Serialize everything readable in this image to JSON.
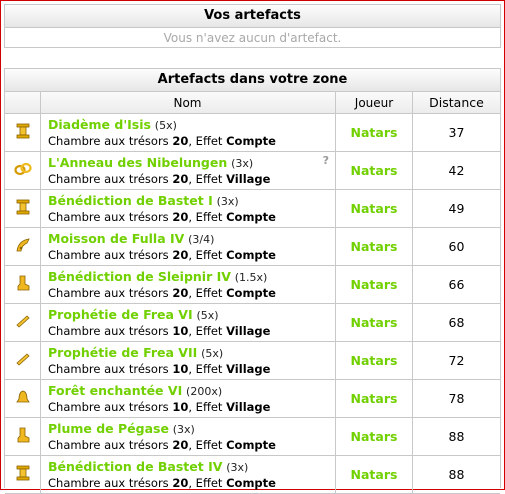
{
  "own_section": {
    "title": "Vos artefacts",
    "empty_text": "Vous n'avez aucun d'artefact."
  },
  "zone_section": {
    "title": "Artefacts dans votre zone",
    "columns": {
      "name": "Nom",
      "player": "Joueur",
      "distance": "Distance"
    },
    "desc_prefix": "Chambre aux trésors",
    "desc_effect": "Effet",
    "help_mark": "?",
    "rows": [
      {
        "icon": "pillar-icon",
        "name": "Diadème d'Isis",
        "bonus": "(5x)",
        "level": "20",
        "effect": "Compte",
        "player": "Natars",
        "distance": "37"
      },
      {
        "icon": "ring-icon",
        "name": "L'Anneau des Nibelungen",
        "bonus": "(3x)",
        "level": "20",
        "effect": "Village",
        "player": "Natars",
        "distance": "42"
      },
      {
        "icon": "pillar-icon",
        "name": "Bénédiction de Bastet I",
        "bonus": "(3x)",
        "level": "20",
        "effect": "Compte",
        "player": "Natars",
        "distance": "49"
      },
      {
        "icon": "horn-icon",
        "name": "Moisson de Fulla IV",
        "bonus": "(3/4)",
        "level": "20",
        "effect": "Compte",
        "player": "Natars",
        "distance": "60"
      },
      {
        "icon": "boot-icon",
        "name": "Bénédiction de Sleipnir IV",
        "bonus": "(1.5x)",
        "level": "20",
        "effect": "Compte",
        "player": "Natars",
        "distance": "66"
      },
      {
        "icon": "scroll-icon",
        "name": "Prophétie de Frea VI",
        "bonus": "(5x)",
        "level": "10",
        "effect": "Village",
        "player": "Natars",
        "distance": "68"
      },
      {
        "icon": "scroll-icon",
        "name": "Prophétie de Frea VII",
        "bonus": "(5x)",
        "level": "10",
        "effect": "Village",
        "player": "Natars",
        "distance": "72"
      },
      {
        "icon": "bell-icon",
        "name": "Forêt enchantée VI",
        "bonus": "(200x)",
        "level": "10",
        "effect": "Village",
        "player": "Natars",
        "distance": "78"
      },
      {
        "icon": "boot-icon",
        "name": "Plume de Pégase",
        "bonus": "(3x)",
        "level": "20",
        "effect": "Compte",
        "player": "Natars",
        "distance": "88"
      },
      {
        "icon": "pillar-icon",
        "name": "Bénédiction de Bastet IV",
        "bonus": "(3x)",
        "level": "20",
        "effect": "Compte",
        "player": "Natars",
        "distance": "88"
      }
    ]
  }
}
